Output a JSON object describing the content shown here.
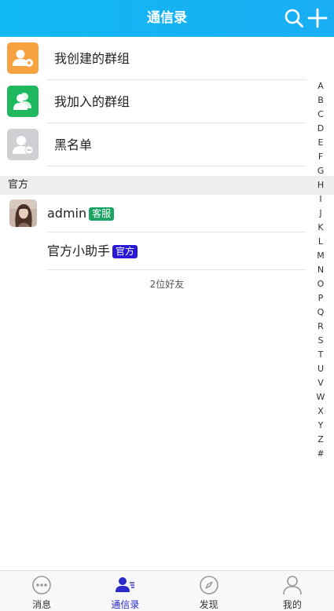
{
  "header": {
    "title": "通信录"
  },
  "groups": [
    {
      "label": "我创建的群组",
      "color": "#f7a240",
      "icon": "user-plus-icon"
    },
    {
      "label": "我加入的群组",
      "color": "#1fb85f",
      "icon": "users-icon"
    },
    {
      "label": "黑名单",
      "color": "#d0d0d4",
      "icon": "user-block-icon"
    }
  ],
  "section": {
    "title": "官方"
  },
  "friends": [
    {
      "name": "admin",
      "badge": "客服",
      "badge_color": "#1aa362"
    },
    {
      "name": "官方小助手",
      "badge": "官方",
      "badge_color": "#2a18d8"
    }
  ],
  "friend_count": "2位好友",
  "index_letters": [
    "A",
    "B",
    "C",
    "D",
    "E",
    "F",
    "G",
    "H",
    "I",
    "J",
    "K",
    "L",
    "M",
    "N",
    "O",
    "P",
    "Q",
    "R",
    "S",
    "T",
    "U",
    "V",
    "W",
    "X",
    "Y",
    "Z",
    "#"
  ],
  "tabs": [
    {
      "label": "消息",
      "icon": "chat-bubble-icon",
      "active": false
    },
    {
      "label": "通信录",
      "icon": "contacts-icon",
      "active": true
    },
    {
      "label": "发现",
      "icon": "compass-icon",
      "active": false
    },
    {
      "label": "我的",
      "icon": "person-icon",
      "active": false
    }
  ],
  "colors": {
    "header": "#13b6f4",
    "active_tab": "#2b2bc9"
  }
}
